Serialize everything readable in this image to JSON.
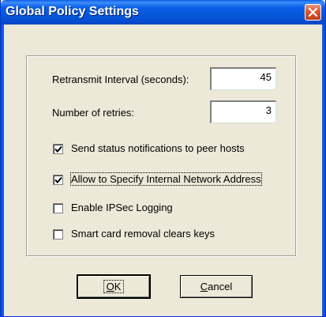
{
  "window": {
    "title": "Global Policy Settings"
  },
  "fields": {
    "retransmit_label": "Retransmit Interval (seconds):",
    "retransmit_value": "45",
    "retries_label": "Number of retries:",
    "retries_value": "3"
  },
  "options": [
    {
      "label": "Send status notifications to peer hosts",
      "checked": true
    },
    {
      "label": "Allow to Specify Internal Network Address",
      "checked": true
    },
    {
      "label": "Enable IPSec Logging",
      "checked": false
    },
    {
      "label": "Smart card removal clears keys",
      "checked": false
    }
  ],
  "buttons": {
    "ok_mnemonic": "O",
    "ok_rest": "K",
    "cancel_mnemonic": "C",
    "cancel_rest": "ancel"
  },
  "icons": {
    "close": "close-x-icon",
    "check": "checkmark-icon"
  },
  "colors": {
    "titlebar": "#0a5fe5",
    "close_button": "#d7562f",
    "dialog_bg": "#ece9d8"
  }
}
